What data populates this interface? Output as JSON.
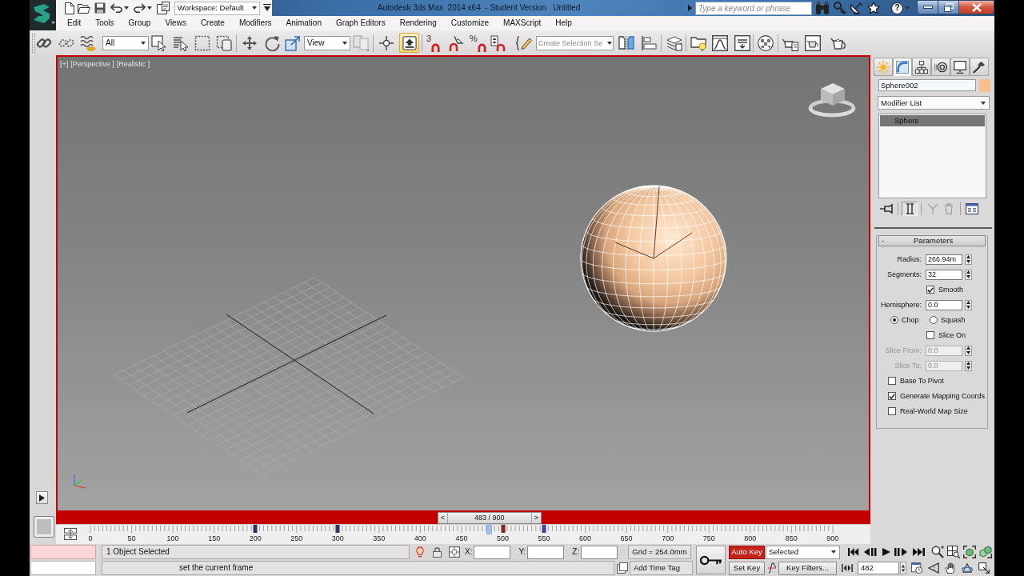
{
  "title_bar": {
    "title": "Autodesk 3ds Max  2014 x64  - Student Version   Untitled",
    "workspace": "Workspace: Default",
    "search": {
      "placeholder": "Type a keyword or phrase"
    },
    "help": "?"
  },
  "menu": [
    "Edit",
    "Tools",
    "Group",
    "Views",
    "Create",
    "Modifiers",
    "Animation",
    "Graph Editors",
    "Rendering",
    "Customize",
    "MAXScript",
    "Help"
  ],
  "main_toolbar": {
    "selection_filter": "All",
    "coordinate_system": "View",
    "toggle_on": true,
    "snap_label": "3",
    "percent_label": "%",
    "named_selection": {
      "placeholder": "Create Selection Se"
    }
  },
  "viewport": {
    "labels": [
      "[+]",
      "[Perspective ]",
      "[Realistic ]"
    ]
  },
  "command_panel": {
    "tabs": [
      {
        "selected": false
      },
      {
        "selected": true
      },
      {
        "selected": false
      },
      {
        "selected": false
      },
      {
        "selected": false
      },
      {
        "selected": false
      }
    ],
    "object_name": "Sphere002",
    "modifier_list": "Modifier List",
    "modifier_stack": [
      {
        "label": "Sphere",
        "selected": true
      }
    ],
    "stack_tools": [
      {
        "on": false,
        "disabled": false
      },
      {
        "on": true,
        "disabled": false
      },
      {
        "on": false,
        "disabled": true
      },
      {
        "on": false,
        "disabled": true
      },
      {
        "on": false,
        "disabled": false
      }
    ],
    "rollout": {
      "sign": "-",
      "title": "Parameters"
    },
    "parameters": [
      {
        "kind": "spinner",
        "label": "Radius:",
        "value": "266.94m",
        "disabled": false
      },
      {
        "kind": "spinner",
        "label": "Segments:",
        "value": "32",
        "disabled": false
      },
      {
        "kind": "inline_checkbox",
        "label": "Smooth",
        "checked": true
      },
      {
        "kind": "spinner",
        "label": "Hemisphere:",
        "value": "0.0",
        "disabled": false
      },
      {
        "kind": "radio_group",
        "options": [
          {
            "label": "Chop",
            "selected": true
          },
          {
            "label": "Squash",
            "selected": false
          }
        ]
      },
      {
        "kind": "inline_checkbox",
        "label": "Slice On",
        "checked": false
      },
      {
        "kind": "spinner",
        "label": "Slice From:",
        "value": "0.0",
        "disabled": true
      },
      {
        "kind": "spinner",
        "label": "Slice To:",
        "value": "0.0",
        "disabled": true
      },
      {
        "kind": "checkbox",
        "label": "Base To Pivot",
        "checked": false
      },
      {
        "kind": "checkbox",
        "label": "Generate Mapping Coords",
        "checked": true
      },
      {
        "kind": "checkbox",
        "label": "Real-World Map Size",
        "checked": false
      }
    ]
  },
  "time_slider": {
    "previous": "<",
    "label": "483 / 900",
    "next": ">",
    "level": 0.537
  },
  "track_bar": {
    "ticks": [
      "0",
      "50",
      "100",
      "150",
      "200",
      "250",
      "300",
      "350",
      "400",
      "450",
      "500",
      "550",
      "600",
      "650",
      "700",
      "750",
      "800",
      "850",
      "900"
    ],
    "keys": [
      {
        "level": 0.222,
        "color": "#2c3562"
      },
      {
        "level": 0.333,
        "color": "#2c3562"
      },
      {
        "level": 0.556,
        "color": "#8a2323"
      },
      {
        "level": 0.611,
        "color": "#3b3fa6"
      }
    ]
  },
  "status_bar": {
    "selection": "1 Object Selected",
    "coordinates": [
      "X:",
      "Y:",
      "Z:"
    ],
    "grid": "Grid = 254.0mm",
    "prompt": "set the current frame",
    "time_tag": "Add Time Tag",
    "auto_key": {
      "label": "Auto Key",
      "on": true
    },
    "key_mode": "Selected",
    "set_key": "Set Key",
    "key_filters": "Key Filters...",
    "current_frame": "482"
  }
}
